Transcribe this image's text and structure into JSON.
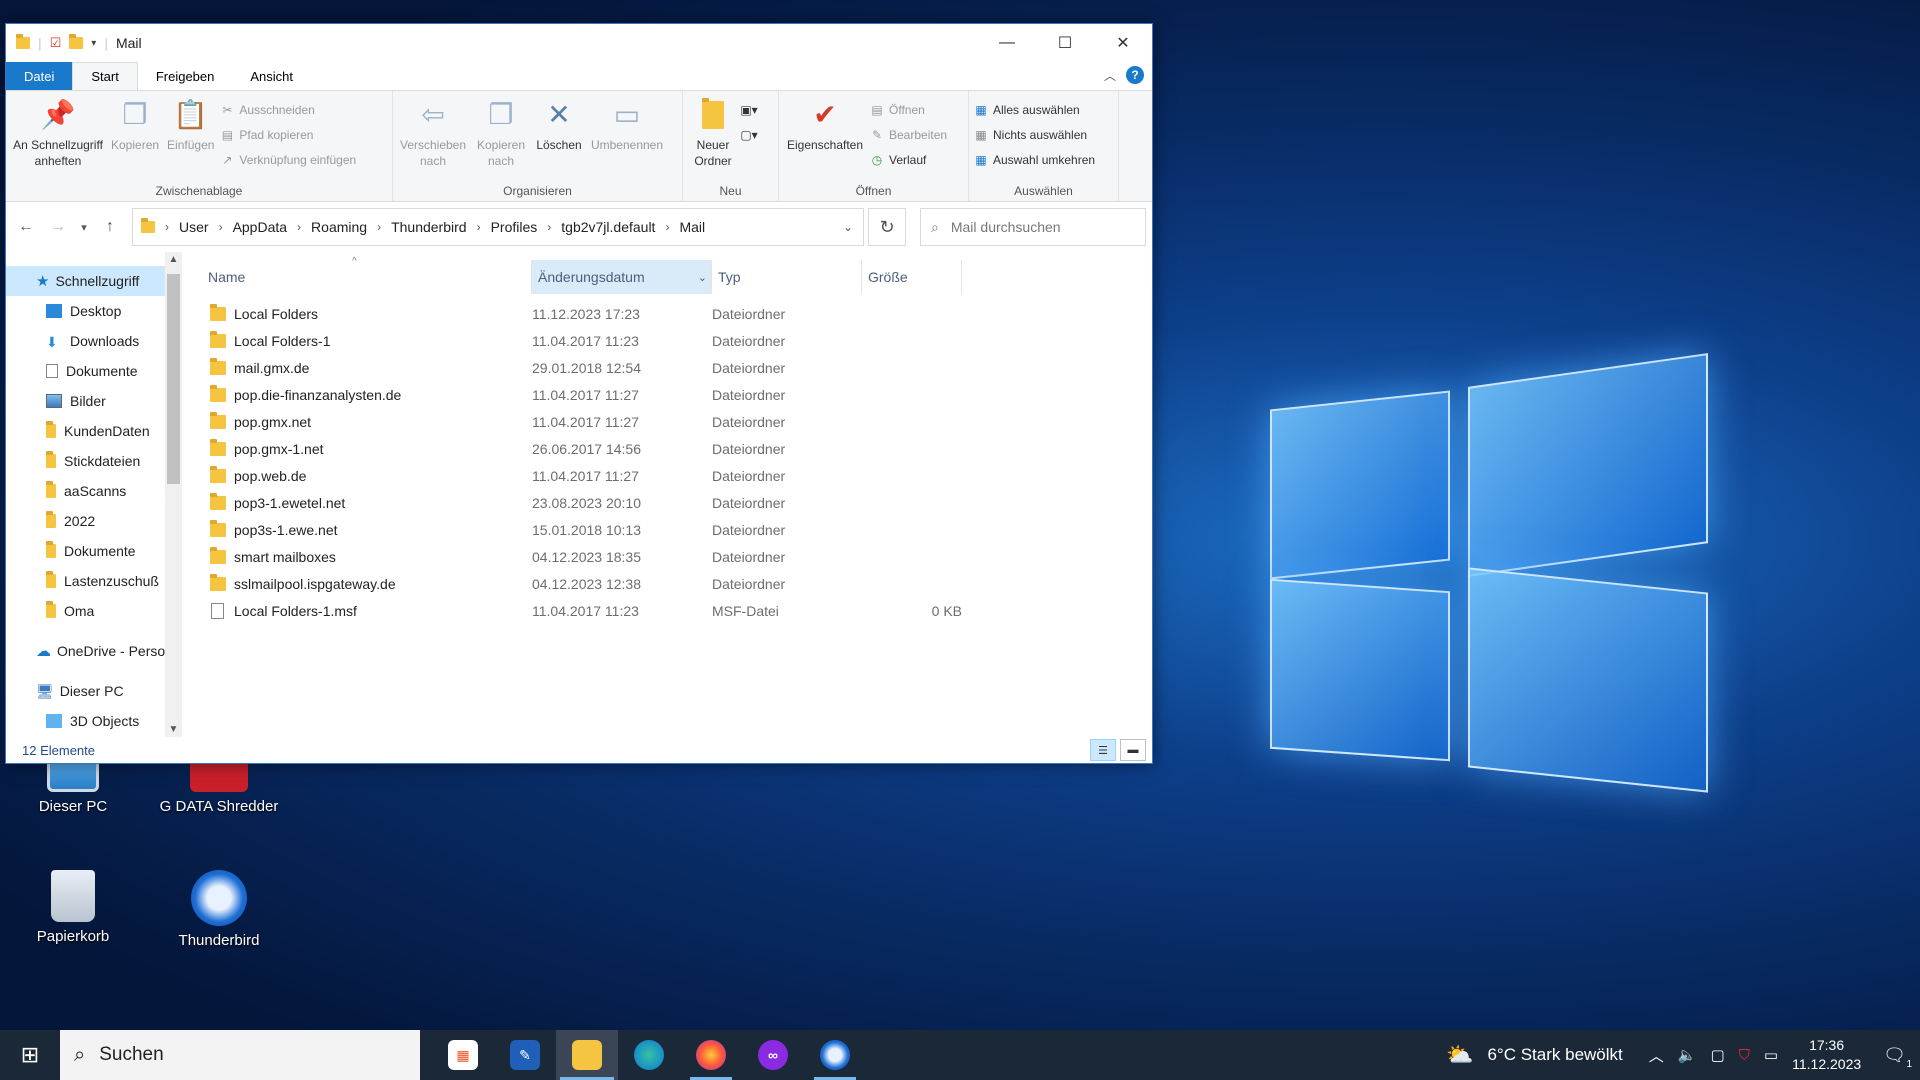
{
  "window": {
    "title": "Mail",
    "menu_tabs": [
      "Datei",
      "Start",
      "Freigeben",
      "Ansicht"
    ]
  },
  "ribbon": {
    "groups": {
      "clipboard": "Zwischenablage",
      "organize": "Organisieren",
      "new": "Neu",
      "open": "Öffnen",
      "select": "Auswählen"
    },
    "pin_label": "An Schnellzugriff anheften",
    "copy_label": "Kopieren",
    "paste_label": "Einfügen",
    "cut_label": "Ausschneiden",
    "copy_path_label": "Pfad kopieren",
    "paste_shortcut_label": "Verknüpfung einfügen",
    "move_to_label": "Verschieben nach",
    "copy_to_label": "Kopieren nach",
    "delete_label": "Löschen",
    "rename_label": "Umbenennen",
    "new_folder_label": "Neuer Ordner",
    "properties_label": "Eigenschaften",
    "open_label": "Öffnen",
    "edit_label": "Bearbeiten",
    "history_label": "Verlauf",
    "select_all_label": "Alles auswählen",
    "select_none_label": "Nichts auswählen",
    "invert_selection_label": "Auswahl umkehren"
  },
  "address": {
    "crumbs": [
      "User",
      "AppData",
      "Roaming",
      "Thunderbird",
      "Profiles",
      "tgb2v7jl.default",
      "Mail"
    ],
    "search_placeholder": "Mail durchsuchen"
  },
  "nav": {
    "quick_access": "Schnellzugriff",
    "items": [
      "Desktop",
      "Downloads",
      "Dokumente",
      "Bilder",
      "KundenDaten",
      "Stickdateien",
      "aaScanns",
      "2022",
      "Dokumente",
      "Lastenzuschuß",
      "Oma"
    ],
    "onedrive": "OneDrive - Person",
    "this_pc": "Dieser PC",
    "objects3d": "3D Objects"
  },
  "columns": {
    "name": "Name",
    "date": "Änderungsdatum",
    "type": "Typ",
    "size": "Größe"
  },
  "files": [
    {
      "name": "Local Folders",
      "date": "11.12.2023 17:23",
      "type": "Dateiordner",
      "size": "",
      "kind": "folder"
    },
    {
      "name": "Local Folders-1",
      "date": "11.04.2017 11:23",
      "type": "Dateiordner",
      "size": "",
      "kind": "folder"
    },
    {
      "name": "mail.gmx.de",
      "date": "29.01.2018 12:54",
      "type": "Dateiordner",
      "size": "",
      "kind": "folder"
    },
    {
      "name": "pop.die-finanzanalysten.de",
      "date": "11.04.2017 11:27",
      "type": "Dateiordner",
      "size": "",
      "kind": "folder"
    },
    {
      "name": "pop.gmx.net",
      "date": "11.04.2017 11:27",
      "type": "Dateiordner",
      "size": "",
      "kind": "folder"
    },
    {
      "name": "pop.gmx-1.net",
      "date": "26.06.2017 14:56",
      "type": "Dateiordner",
      "size": "",
      "kind": "folder"
    },
    {
      "name": "pop.web.de",
      "date": "11.04.2017 11:27",
      "type": "Dateiordner",
      "size": "",
      "kind": "folder"
    },
    {
      "name": "pop3-1.ewetel.net",
      "date": "23.08.2023 20:10",
      "type": "Dateiordner",
      "size": "",
      "kind": "folder"
    },
    {
      "name": "pop3s-1.ewe.net",
      "date": "15.01.2018 10:13",
      "type": "Dateiordner",
      "size": "",
      "kind": "folder"
    },
    {
      "name": "smart mailboxes",
      "date": "04.12.2023 18:35",
      "type": "Dateiordner",
      "size": "",
      "kind": "folder"
    },
    {
      "name": "sslmailpool.ispgateway.de",
      "date": "04.12.2023 12:38",
      "type": "Dateiordner",
      "size": "",
      "kind": "folder"
    },
    {
      "name": "Local Folders-1.msf",
      "date": "11.04.2017 11:23",
      "type": "MSF-Datei",
      "size": "0 KB",
      "kind": "file"
    }
  ],
  "status": {
    "count": "12 Elemente"
  },
  "desktop_icons": [
    "Dieser PC",
    "G DATA Shredder",
    "Papierkorb",
    "Thunderbird"
  ],
  "taskbar": {
    "search": "Suchen",
    "weather": "6°C  Stark bewölkt",
    "time": "17:36",
    "date": "11.12.2023",
    "notification_count": "1"
  },
  "colors": {
    "accent": "#1979ca",
    "selection": "#cce8ff",
    "folder": "#f5c542"
  }
}
